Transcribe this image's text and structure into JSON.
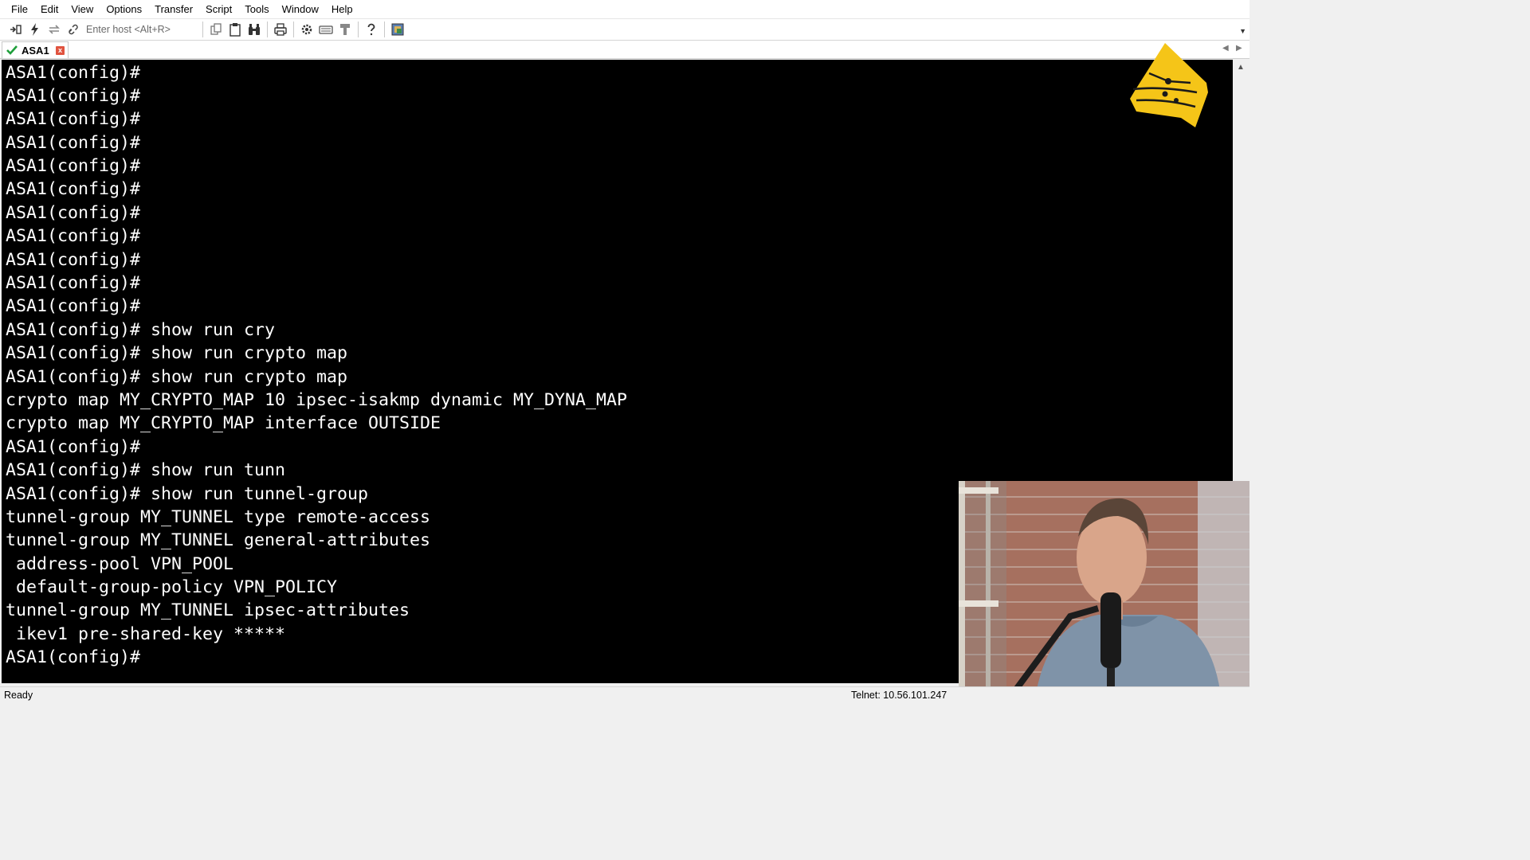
{
  "menu": {
    "items": [
      {
        "label": "File"
      },
      {
        "label": "Edit"
      },
      {
        "label": "View"
      },
      {
        "label": "Options"
      },
      {
        "label": "Transfer"
      },
      {
        "label": "Script"
      },
      {
        "label": "Tools"
      },
      {
        "label": "Window"
      },
      {
        "label": "Help"
      }
    ]
  },
  "toolbar": {
    "host_placeholder": "Enter host <Alt+R>",
    "icons": [
      "connect-icon",
      "quick-connect-icon",
      "reconnect-icon",
      "disconnect-icon",
      "copy-icon",
      "paste-icon",
      "find-icon",
      "print-icon",
      "settings-icon",
      "keymap-icon",
      "tools-icon",
      "help-icon",
      "sftp-icon"
    ]
  },
  "tab": {
    "label": "ASA1",
    "close_label": "x",
    "status": "connected"
  },
  "terminal": {
    "lines": [
      "ASA1(config)#",
      "ASA1(config)#",
      "ASA1(config)#",
      "ASA1(config)#",
      "ASA1(config)#",
      "ASA1(config)#",
      "ASA1(config)#",
      "ASA1(config)#",
      "ASA1(config)#",
      "ASA1(config)#",
      "ASA1(config)#",
      "ASA1(config)# show run cry",
      "ASA1(config)# show run crypto map",
      "ASA1(config)# show run crypto map",
      "crypto map MY_CRYPTO_MAP 10 ipsec-isakmp dynamic MY_DYNA_MAP",
      "crypto map MY_CRYPTO_MAP interface OUTSIDE",
      "ASA1(config)#",
      "ASA1(config)# show run tunn",
      "ASA1(config)# show run tunnel-group",
      "tunnel-group MY_TUNNEL type remote-access",
      "tunnel-group MY_TUNNEL general-attributes",
      " address-pool VPN_POOL",
      " default-group-policy VPN_POLICY",
      "tunnel-group MY_TUNNEL ipsec-attributes",
      " ikev1 pre-shared-key *****",
      "ASA1(config)#"
    ]
  },
  "status": {
    "ready": "Ready",
    "connection": "Telnet: 10.56.101.247"
  },
  "colors": {
    "terminal_bg": "#000000",
    "terminal_fg": "#ffffff",
    "logo": "#f5c518",
    "check": "#1e9e3a",
    "tab_close": "#e0533f"
  }
}
